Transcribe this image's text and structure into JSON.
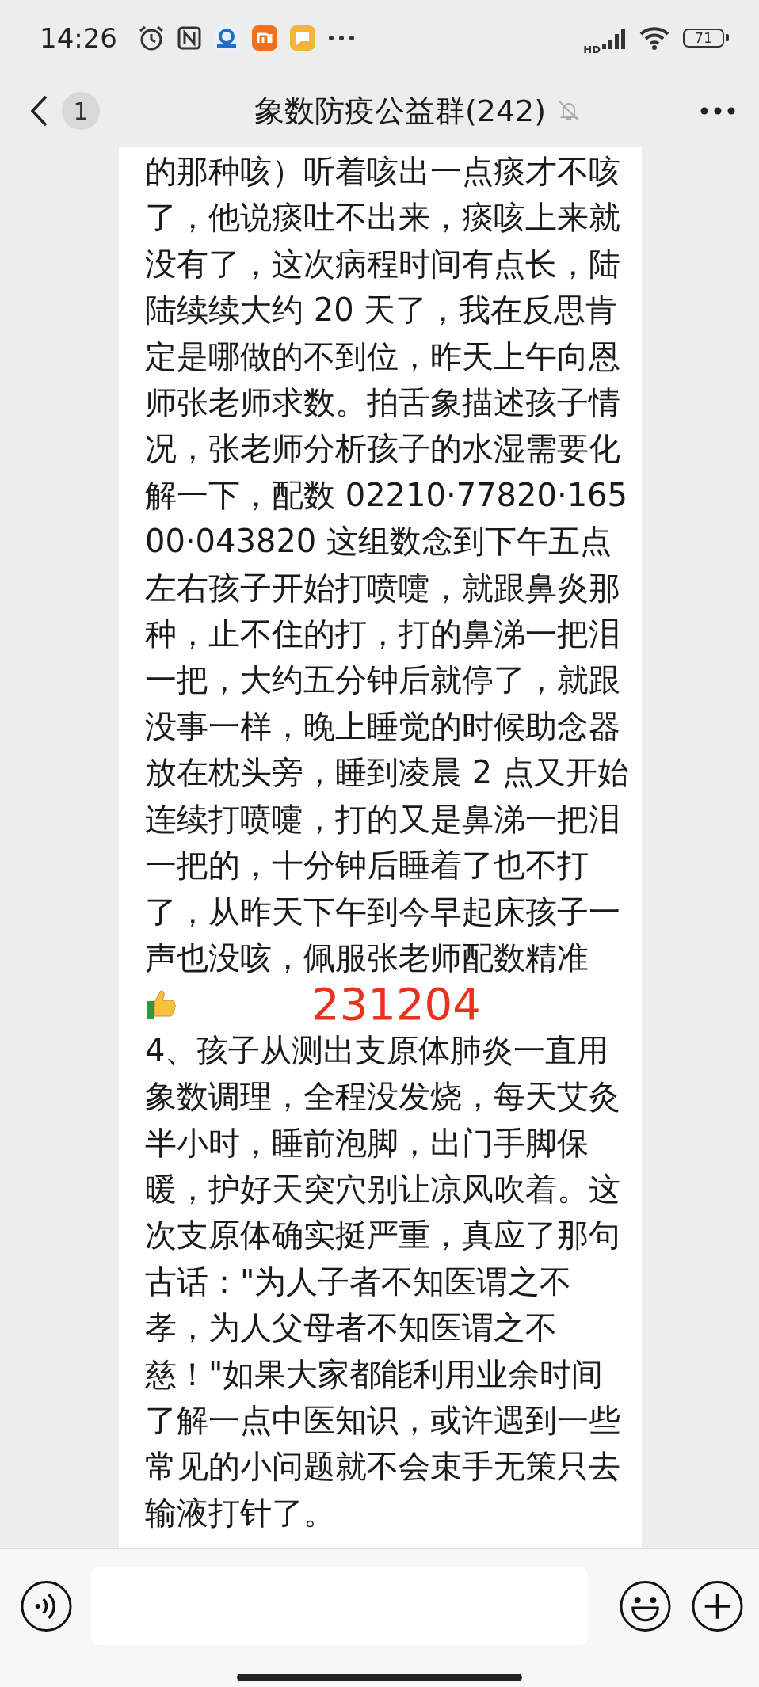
{
  "status_bar": {
    "time": "14:26",
    "network": "HD",
    "battery": "71"
  },
  "header": {
    "unread": "1",
    "title": "象数防疫公益群(242)",
    "muted": true
  },
  "messages": [
    {
      "kind": "text",
      "text": "的那种咳）听着咳出一点痰才不咳了，他说痰吐不出来，痰咳上来就没有了，这次病程时间有点长，陆陆续续大约 20 天了，我在反思肯定是哪做的不到位，昨天上午向恩师张老师求数。拍舌象描述孩子情况，张老师分析孩子的水湿需要化解一下，配数 02210·77820·16500·043820 这组数念到下午五点左右孩子开始打喷嚏，就跟鼻炎那种，止不住的打，打的鼻涕一把泪一把，大约五分钟后就停了，就跟没事一样，晚上睡觉的时候助念器放在枕头旁，睡到凌晨 2 点又开始连续打喷嚏，打的又是鼻涕一把泪一把的，十分钟后睡着了也不打了，从昨天下午到今早起床孩子一声也没咳，佩服张老师配数精准"
    },
    {
      "kind": "thumbs",
      "stamp": "231204"
    },
    {
      "kind": "text",
      "text": "4、孩子从测出支原体肺炎一直用象数调理，全程没发烧，每天艾灸半小时，睡前泡脚，出门手脚保暖，护好天突穴别让凉风吹着。这次支原体确实挺严重，真应了那句古话：\"为人子者不知医谓之不孝，为人父母者不知医谓之不慈！\"如果大家都能利用业余时间了解一点中医知识，或许遇到一些常见的小问题就不会束手无策只去输液打针了。"
    }
  ]
}
